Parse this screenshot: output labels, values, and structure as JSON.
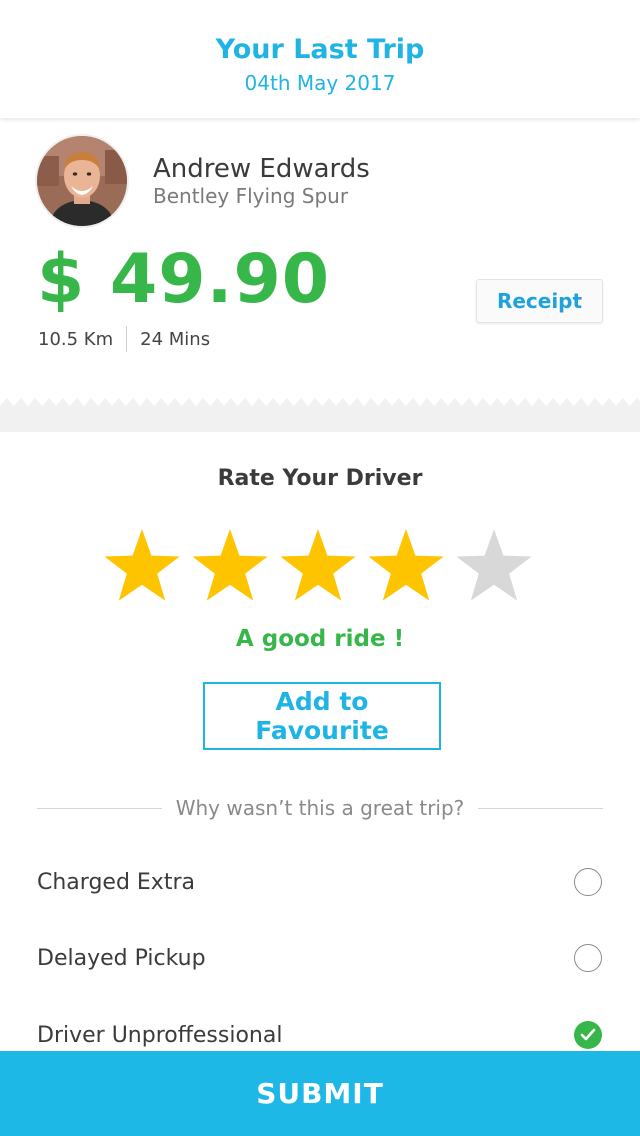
{
  "header": {
    "title": "Your Last Trip",
    "date": "04th May 2017"
  },
  "trip": {
    "driver_name": "Andrew Edwards",
    "car": "Bentley Flying Spur",
    "price": "$ 49.90",
    "distance": "10.5 Km",
    "duration": "24 Mins",
    "receipt_label": "Receipt"
  },
  "rating": {
    "title": "Rate Your Driver",
    "value": 4,
    "max": 5,
    "feedback_text": "A good ride !",
    "favourite_label": "Add to Favourite",
    "filled_color": "#ffc400",
    "empty_color": "#d8d8d8"
  },
  "issues": {
    "prompt": "Why wasn’t this a great trip?",
    "options": [
      {
        "label": "Charged Extra",
        "checked": false
      },
      {
        "label": "Delayed Pickup",
        "checked": false
      },
      {
        "label": "Driver Unproffessional",
        "checked": true
      }
    ]
  },
  "submit_label": "SUBMIT",
  "colors": {
    "accent_blue": "#1fb4e4",
    "price_green": "#37b749"
  },
  "icons": {
    "avatar": "driver-avatar",
    "star": "star-icon",
    "check": "checkmark-icon"
  }
}
